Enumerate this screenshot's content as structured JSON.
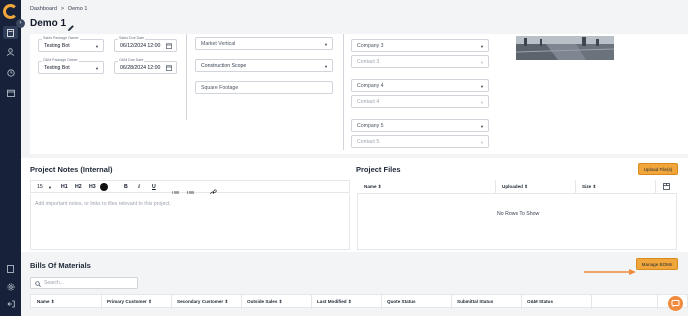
{
  "breadcrumb": {
    "item1": "Dashboard",
    "sep": ">",
    "item2": "Demo 1"
  },
  "title": "Demo 1",
  "details": {
    "sales_owner": {
      "label": "Sales Package Owner",
      "value": "Testing Bot"
    },
    "sales_due": {
      "label": "Sales Due Date",
      "value": "06/12/2024 12:00"
    },
    "om_owner": {
      "label": "O&M Package Owner",
      "value": "Testing Bot"
    },
    "om_due": {
      "label": "O&M Due Date",
      "value": "06/28/2024 12:00"
    },
    "market_vertical": "Market Vertical",
    "construction_scope": "Construction Scope",
    "square_footage": "Square Footage",
    "company3": "Company 3",
    "contact3": "Contact 3",
    "company4": "Company 4",
    "contact4": "Contact 4",
    "company5": "Company 5",
    "contact5": "Contact 5"
  },
  "notes": {
    "title": "Project Notes (Internal)",
    "font_size": "15",
    "h1": "H1",
    "h2": "H2",
    "h3": "H3",
    "bold": "B",
    "italic": "I",
    "underline": "U",
    "placeholder": "Add important notes, or links to files relevant to this project."
  },
  "files": {
    "title": "Project Files",
    "upload_label": "Upload File(s)",
    "columns": [
      "Name",
      "Uploaded",
      "Size"
    ],
    "empty": "No Rows To Show"
  },
  "boms": {
    "title": "Bills Of Materials",
    "manage_label": "Manage BOMs",
    "search_placeholder": "Search...",
    "columns": [
      "Name",
      "Primary Customer",
      "Secondary Customer",
      "Outside Sales",
      "Last Modified",
      "Quote Status",
      "Submittal Status",
      "O&M Status"
    ]
  },
  "colors": {
    "sidebar": "#17223a",
    "accent": "#f0a63a",
    "arrow": "#f08a3c"
  }
}
